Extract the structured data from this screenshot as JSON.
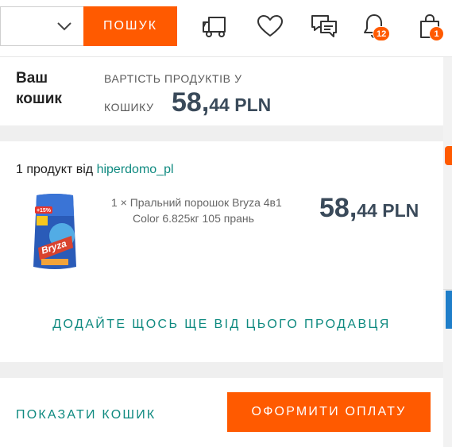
{
  "header": {
    "search_button": "ПОШУК",
    "notifications_count": "12",
    "cart_count": "1"
  },
  "cart": {
    "title": "Ваш кошик",
    "total_label_line1": "ВАРТІСТЬ ПРОДУКТІВ У",
    "total_label_line2": "КОШИКУ",
    "total_int": "58,",
    "total_frac": "44 PLN"
  },
  "seller": {
    "prefix": "1 продукт від ",
    "name": "hiperdomo_pl"
  },
  "product": {
    "name_line1": "1 × Пральний порошок Bryza 4в1",
    "name_line2": "Color 6.825кг 105 прань",
    "price_int": "58,",
    "price_frac": "44 PLN",
    "image_brand": "Bryza",
    "image_badge": "+15%"
  },
  "actions": {
    "add_more": "ДОДАЙТЕ ЩОСЬ ЩЕ ВІД ЦЬОГО ПРОДАВЦЯ",
    "show_cart": "ПОКАЗАТИ КОШИК",
    "checkout": "ОФОРМИТИ ОПЛАТУ"
  },
  "colors": {
    "accent": "#ff5a00",
    "link": "#0f8a80",
    "price": "#3a4a5a"
  },
  "icons": [
    "chevron-down-icon",
    "truck-icon",
    "heart-icon",
    "chat-icon",
    "bell-icon",
    "shopping-bag-icon"
  ]
}
